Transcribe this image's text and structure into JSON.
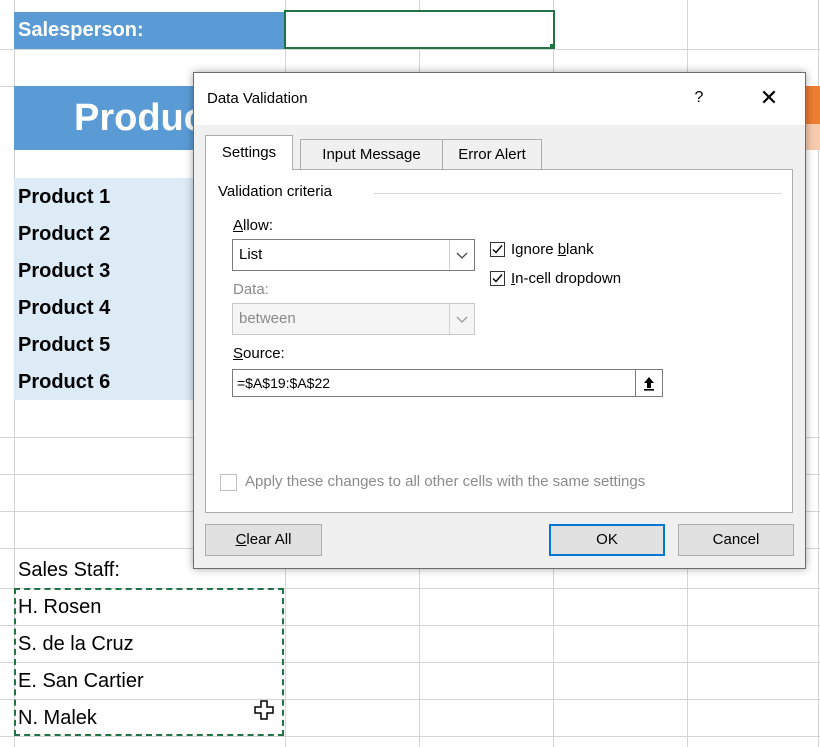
{
  "sheet": {
    "salesperson_label": "Salesperson:",
    "banner_title": "Produc",
    "products": [
      "Product 1",
      "Product 2",
      "Product 3",
      "Product 4",
      "Product 5",
      "Product 6"
    ],
    "sales_staff_label": "Sales Staff:",
    "staff": [
      "H. Rosen",
      "S. de la Cruz",
      "E. San Cartier",
      "N. Malek"
    ]
  },
  "dialog": {
    "title": "Data Validation",
    "help": "?",
    "close": "✕",
    "tabs": [
      {
        "label": "Settings",
        "active": true
      },
      {
        "label": "Input Message",
        "active": false
      },
      {
        "label": "Error Alert",
        "active": false
      }
    ],
    "group_label": "Validation criteria",
    "allow_label_u": "A",
    "allow_label_rest": "llow:",
    "allow_value": "List",
    "data_label": "Data:",
    "data_value": "between",
    "ignore_blank_pre": "Ignore ",
    "ignore_blank_u": "b",
    "ignore_blank_post": "lank",
    "ignore_blank_checked": true,
    "incell_u": "I",
    "incell_post": "n-cell dropdown",
    "incell_checked": true,
    "source_label_u": "S",
    "source_label_rest": "ource:",
    "source_value": "=$A$19:$A$22",
    "apply_label": "Apply these changes to all other cells with the same settings",
    "apply_checked": false,
    "clear_all_u": "C",
    "clear_all_rest": "lear All",
    "ok_label": "OK",
    "cancel_label": "Cancel"
  },
  "colors": {
    "header_blue": "#5b9bd5",
    "product_fill": "#ddebf7",
    "excel_green": "#217346",
    "accent_orange": "#ed7d31",
    "focus_blue": "#0078d7"
  }
}
